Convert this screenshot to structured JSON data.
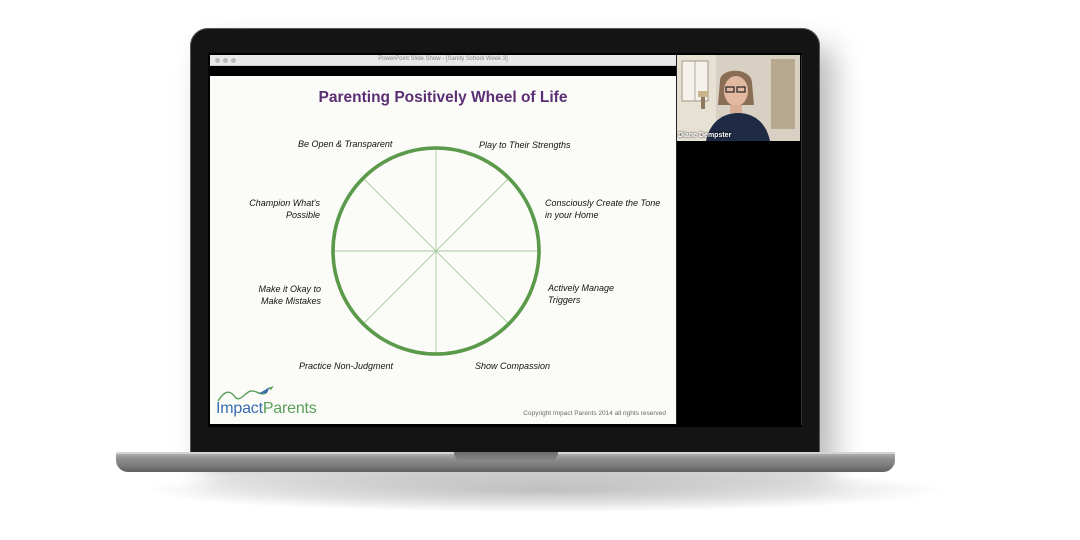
{
  "window": {
    "title": "PowerPoint Slide Show - [Sanity School Week 3]"
  },
  "slide": {
    "title": "Parenting Positively Wheel of Life",
    "wheel_labels": {
      "top_left": "Be Open & Transparent",
      "top_right": "Play to Their Strengths",
      "upper_left": [
        "Champion What's",
        "Possible"
      ],
      "upper_right": [
        "Consciously Create the Tone",
        "in your Home"
      ],
      "lower_left": [
        "Make it Okay to",
        "Make Mistakes"
      ],
      "lower_right": [
        "Actively Manage",
        "Triggers"
      ],
      "bottom_left": "Practice Non-Judgment",
      "bottom_right": "Show Compassion"
    },
    "logo": {
      "impact": "Impact",
      "parents": "Parents"
    },
    "copyright": "Copyright Impact Parents 2014 all rights reserved"
  },
  "video": {
    "participant_name": "Diane Dempster"
  },
  "colors": {
    "title_purple": "#5b2f74",
    "wheel_green": "#5a9a4a",
    "logo_blue": "#3a6db0",
    "logo_green": "#5aa05a"
  }
}
